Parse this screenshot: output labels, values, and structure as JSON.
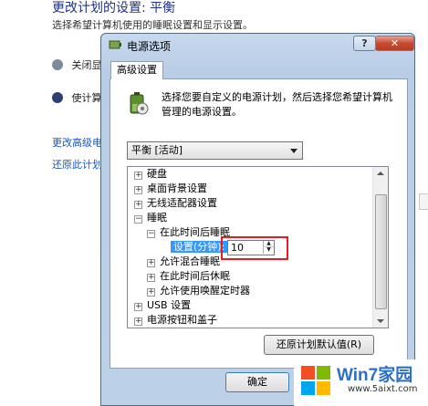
{
  "background": {
    "title": "更改计划的设置: 平衡",
    "description": "选择希望计算机使用的睡眠设置和显示设置。",
    "row1": "关闭显示",
    "row2": "使计算机",
    "link1": "更改高级电源",
    "link2": "还原此计划的默"
  },
  "dialog": {
    "title": "电源选项",
    "help_label": "?",
    "close_label": "✕",
    "tab_label": "高级设置",
    "intro": "选择您要自定义的电源计划，然后选择您希望计算机管理的电源设置。",
    "plan_selected": "平衡 [活动]",
    "tree": [
      {
        "expander": "+",
        "label": "硬盘"
      },
      {
        "expander": "+",
        "label": "桌面背景设置"
      },
      {
        "expander": "+",
        "label": "无线适配器设置"
      },
      {
        "expander": "−",
        "label": "睡眠"
      },
      {
        "expander": "−",
        "label": "在此时间后睡眠"
      },
      {
        "label": "设置(分钟):"
      },
      {
        "expander": "+",
        "label": "允许混合睡眠"
      },
      {
        "expander": "+",
        "label": "在此时间后休眠"
      },
      {
        "expander": "+",
        "label": "允许使用唤醒定时器"
      },
      {
        "expander": "+",
        "label": "USB 设置"
      },
      {
        "expander": "+",
        "label": "电源按钮和盖子"
      }
    ],
    "sleep_minutes_value": "10",
    "spin_up": "▲",
    "spin_down": "▼",
    "restore_label": "还原计划默认值(R)",
    "ok_label": "确定",
    "cancel_label": "取消"
  },
  "watermark": {
    "brand": "Win7家园",
    "url": "www.5aixt.com"
  },
  "colors": {
    "highlight_box": "#e51c23",
    "selection": "#3399ff",
    "link": "#1a55c0"
  }
}
